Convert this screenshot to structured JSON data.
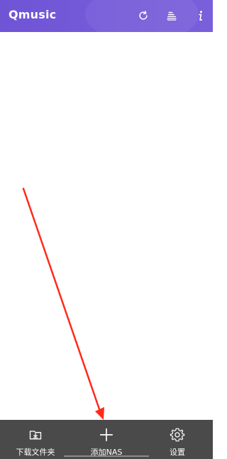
{
  "header": {
    "title": "Qmusic",
    "icons": [
      "refresh-icon",
      "list-icon",
      "info-icon"
    ]
  },
  "bottom_nav": {
    "items": [
      {
        "label": "下载文件夹",
        "icon": "folder-download-icon"
      },
      {
        "label": "添加NAS",
        "icon": "plus-icon"
      },
      {
        "label": "设置",
        "icon": "gear-icon"
      }
    ]
  },
  "colors": {
    "header_bg": "#6f55d6",
    "bottom_bg": "#4a4a4a",
    "arrow": "#ff2a1a"
  }
}
